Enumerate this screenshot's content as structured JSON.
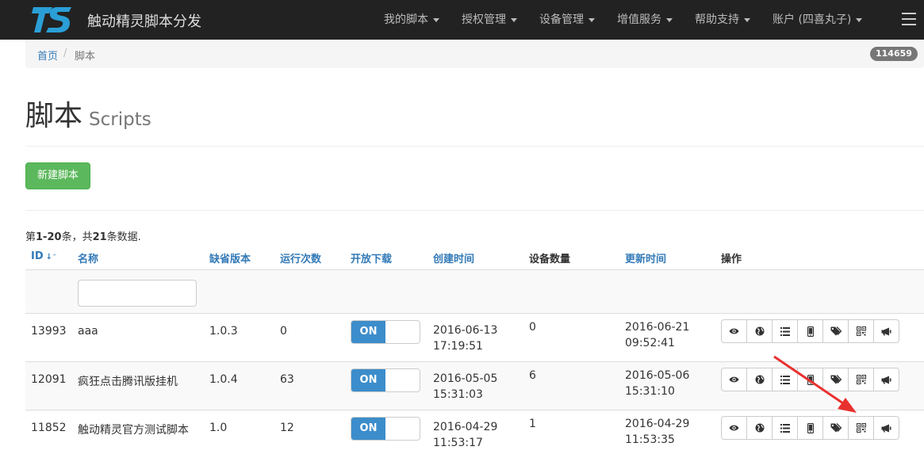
{
  "navbar": {
    "brand": "触动精灵脚本分发",
    "items": [
      {
        "label": "我的脚本"
      },
      {
        "label": "授权管理"
      },
      {
        "label": "设备管理"
      },
      {
        "label": "增值服务"
      },
      {
        "label": "帮助支持"
      },
      {
        "label": "账户 (四喜丸子)"
      }
    ]
  },
  "breadcrumb": {
    "home": "首页",
    "separator": "/",
    "current": "脚本",
    "badge": "114659"
  },
  "page": {
    "title": "脚本",
    "subtitle": "Scripts",
    "new_button": "新建脚本"
  },
  "summary": {
    "prefix": "第",
    "range": "1-20",
    "middle": "条，共",
    "total": "21",
    "suffix": "条数据."
  },
  "table": {
    "headers": {
      "id": "ID",
      "name": "名称",
      "version": "缺省版本",
      "runs": "运行次数",
      "download": "开放下载",
      "created": "创建时间",
      "devices": "设备数量",
      "updated": "更新时间",
      "actions": "操作"
    },
    "rows": [
      {
        "id": "13993",
        "name": "aaa",
        "version": "1.0.3",
        "runs": "0",
        "download": "ON",
        "created_date": "2016-06-13",
        "created_time": "17:19:51",
        "devices": "0",
        "updated_date": "2016-06-21",
        "updated_time": "09:52:41"
      },
      {
        "id": "12091",
        "name": "疯狂点击腾讯版挂机",
        "version": "1.0.4",
        "runs": "63",
        "download": "ON",
        "created_date": "2016-05-05",
        "created_time": "15:31:03",
        "devices": "6",
        "updated_date": "2016-05-06",
        "updated_time": "15:31:10"
      },
      {
        "id": "11852",
        "name": "触动精灵官方测试脚本",
        "version": "1.0",
        "runs": "12",
        "download": "ON",
        "created_date": "2016-04-29",
        "created_time": "11:53:17",
        "devices": "1",
        "updated_date": "2016-04-29",
        "updated_time": "11:53:35"
      }
    ]
  },
  "colors": {
    "navbar_bg": "#222222",
    "link": "#337ab7",
    "success": "#5cb85c",
    "toggle_on": "#3c8dcb",
    "annotation_arrow": "#e8312f"
  }
}
